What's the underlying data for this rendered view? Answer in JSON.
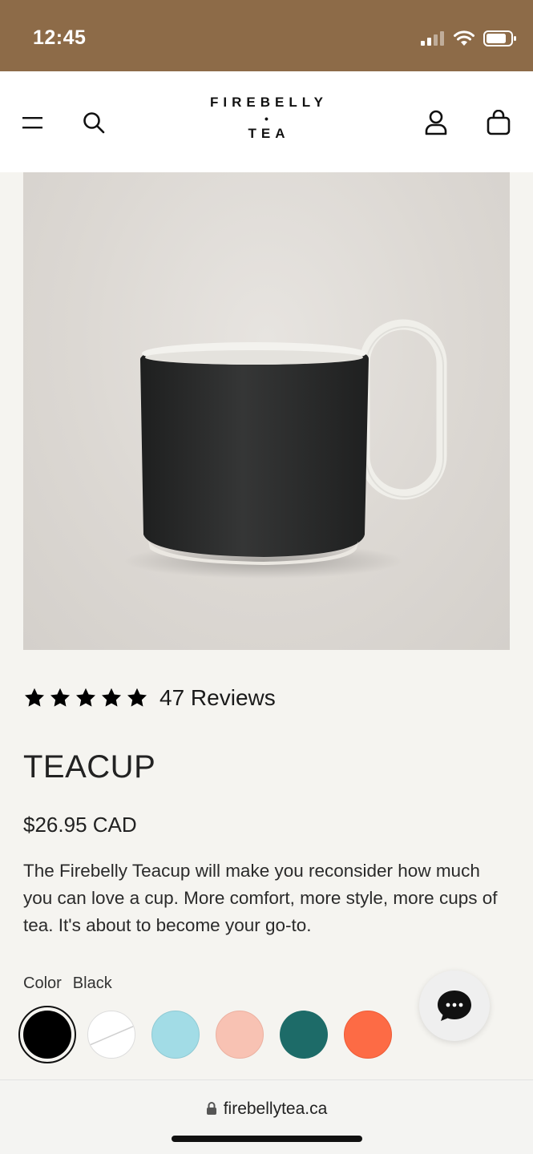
{
  "status_bar": {
    "time": "12:45"
  },
  "header": {
    "logo_top": "FIREBELLY",
    "logo_dot": "•",
    "logo_bottom": "TEA",
    "icons": [
      "menu-icon",
      "search-icon",
      "account-icon",
      "bag-icon"
    ]
  },
  "product": {
    "image_description": "Black teacup with white handle",
    "rating_stars": 5,
    "reviews": "47 Reviews",
    "title": "TEACUP",
    "price": "$26.95 CAD",
    "description": "The Firebelly Teacup will make you reconsider how much you can love a cup. More comfort, more style, more cups of tea. It's about to become your go-to.",
    "color_label": "Color",
    "color_value": "Black",
    "swatches": [
      {
        "name": "black",
        "hex": "#000000",
        "selected": true
      },
      {
        "name": "white",
        "hex": "#ffffff"
      },
      {
        "name": "light-blue",
        "hex": "#a2dce6"
      },
      {
        "name": "peach",
        "hex": "#f8c2b3"
      },
      {
        "name": "teal",
        "hex": "#1d6b68"
      },
      {
        "name": "orange",
        "hex": "#fd6b45"
      }
    ]
  },
  "chat": {
    "icon": "chat-icon"
  },
  "browser": {
    "url": "firebellytea.ca"
  },
  "colors": {
    "status_bar": "#8d6b48",
    "background": "#f5f4f0"
  }
}
